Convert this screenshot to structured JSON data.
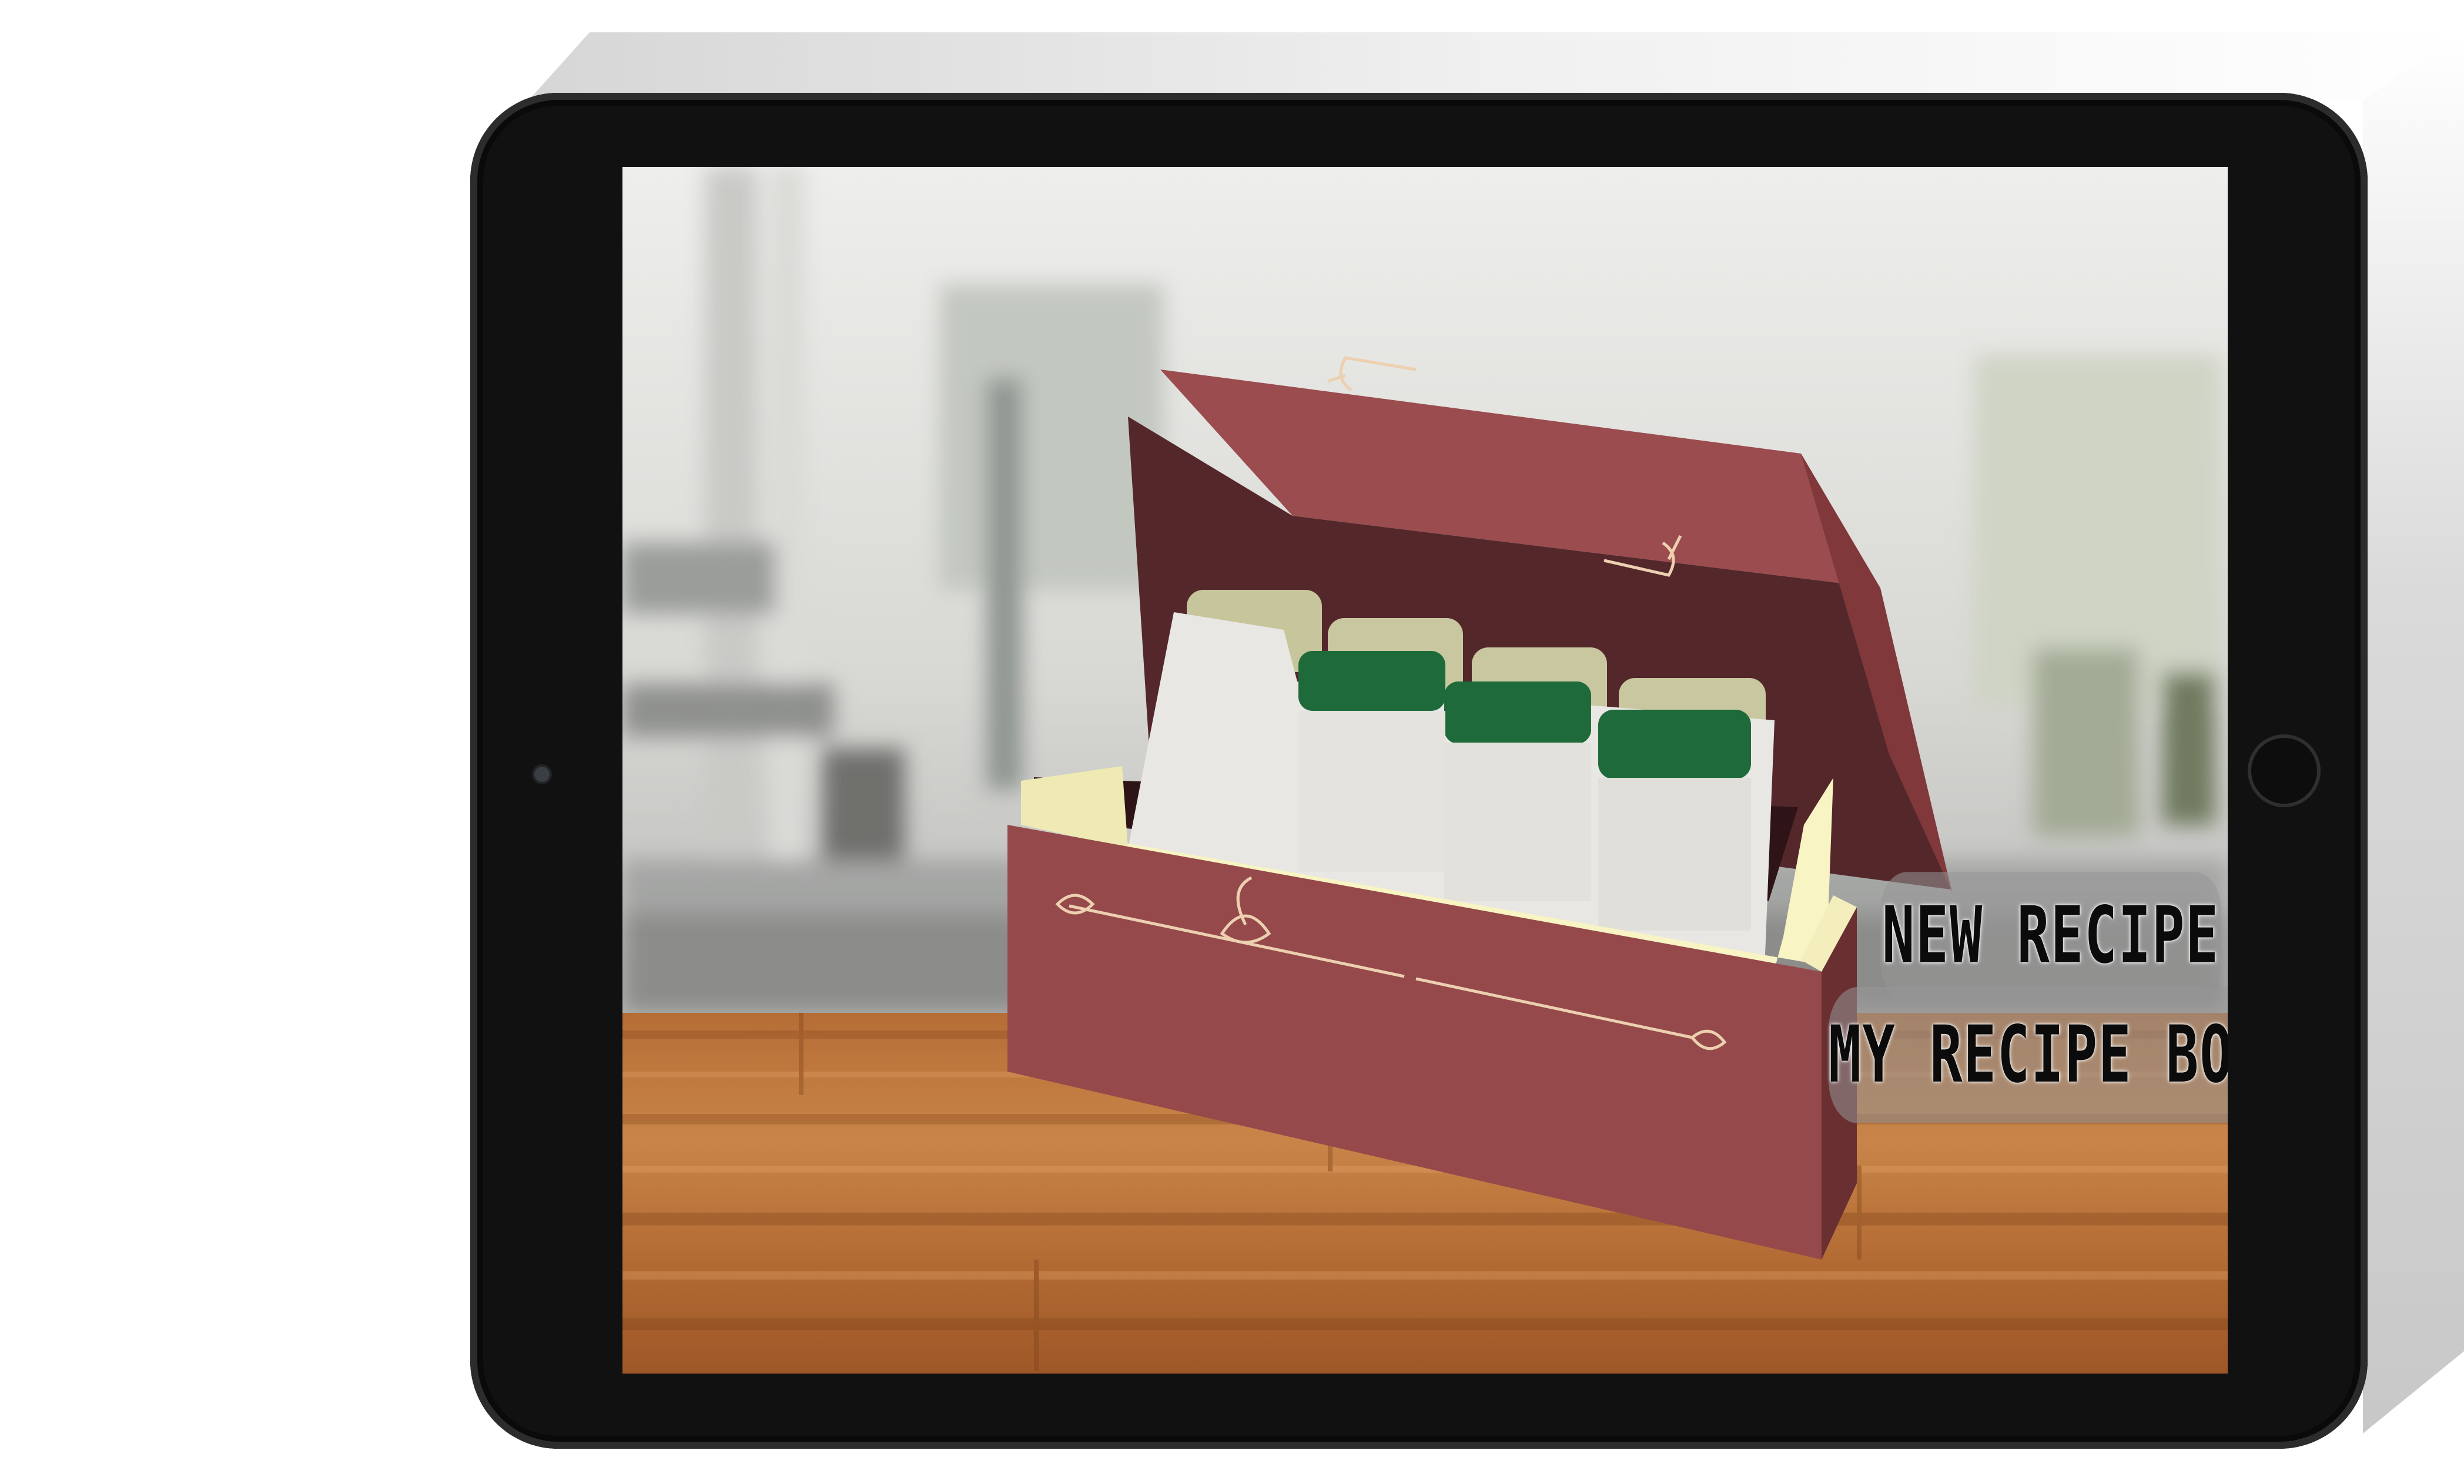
{
  "app": {
    "menu": {
      "new_recipe_label": "NEW RECIPE",
      "recipe_box_label": "MY RECIPE BOX"
    }
  },
  "colors": {
    "bezel": "#111111",
    "box_red": "#94484a",
    "box_dark": "#54272b",
    "tab_green": "#1f6b3b",
    "tab_khaki": "#c6c59a",
    "card": "#e6e5e1",
    "box_liner": "#f8f4c4",
    "ornament": "#e9c9a9",
    "counter_wood": "#c07a3e"
  },
  "icons": {
    "camera": "front-camera-icon",
    "home": "home-button-icon",
    "ornament": "flourish-ornament-icon"
  }
}
